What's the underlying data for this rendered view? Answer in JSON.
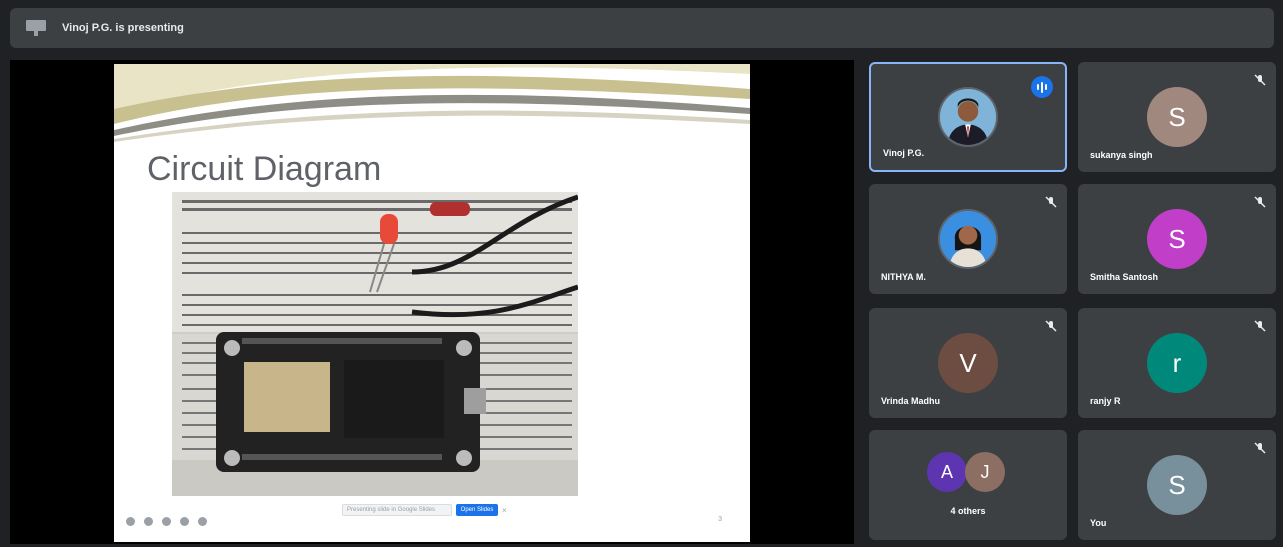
{
  "header": {
    "presenting_text": "Vinoj P.G. is presenting",
    "icon": "present-screen-icon"
  },
  "slide": {
    "title": "Circuit Diagram",
    "image_desc_icon": "circuit-photo",
    "pager_text": "Presenting slide in Google Slides",
    "open_button": "Open Slides",
    "close_glyph": "×",
    "slide_number": "3"
  },
  "participants": [
    {
      "name": "Vinoj P.G.",
      "kind": "photo",
      "speaking": true
    },
    {
      "name": "sukanya singh",
      "initial": "S",
      "color": "#a1887f",
      "muted": true
    },
    {
      "name": "NITHYA M.",
      "kind": "photo",
      "muted": true
    },
    {
      "name": "Smitha Santosh",
      "initial": "S",
      "color": "#c13ec9",
      "muted": true
    },
    {
      "name": "Vrinda Madhu",
      "initial": "V",
      "color": "#6d4c41",
      "muted": true
    },
    {
      "name": "ranjy R",
      "initial": "r",
      "color": "#00897b",
      "muted": true
    },
    {
      "name": "4 others",
      "initials": [
        "A",
        "J"
      ],
      "colors": [
        "#5e35b1",
        "#8d6e63"
      ]
    },
    {
      "name": "You",
      "initial": "S",
      "color": "#78909c",
      "muted": true
    }
  ],
  "colors": {
    "background": "#202124",
    "tile": "#3c4043",
    "active_border": "#8ab4f8",
    "speaking": "#1a73e8"
  }
}
